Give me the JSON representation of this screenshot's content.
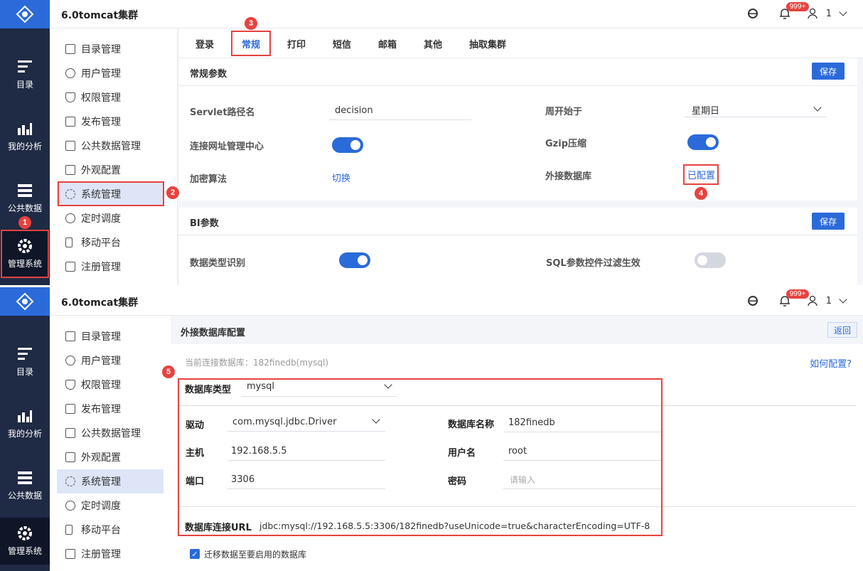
{
  "app_title": "6.0tomcat集群",
  "topbar": {
    "badge": "999+",
    "user": "1"
  },
  "rail": [
    {
      "label": "目录",
      "icon": "catalog-icon"
    },
    {
      "label": "我的分析",
      "icon": "analysis-icon"
    },
    {
      "label": "公共数据",
      "icon": "public-data-icon"
    },
    {
      "label": "管理系统",
      "icon": "gear-icon"
    }
  ],
  "nav": [
    {
      "label": "目录管理"
    },
    {
      "label": "用户管理"
    },
    {
      "label": "权限管理"
    },
    {
      "label": "发布管理"
    },
    {
      "label": "公共数据管理"
    },
    {
      "label": "外观配置"
    },
    {
      "label": "系统管理"
    },
    {
      "label": "定时调度"
    },
    {
      "label": "移动平台"
    },
    {
      "label": "注册管理"
    }
  ],
  "tabs": [
    "登录",
    "常规",
    "打印",
    "短信",
    "邮箱",
    "其他",
    "抽取集群"
  ],
  "general": {
    "title": "常规参数",
    "save": "保存",
    "servlet_label": "Servlet路径名",
    "servlet_value": "decision",
    "week_label": "周开始于",
    "week_value": "星期日",
    "url_center_label": "连接网址管理中心",
    "gzip_label": "Gzip压缩",
    "encrypt_label": "加密算法",
    "encrypt_link": "切换",
    "extdb_label": "外接数据库",
    "extdb_link": "已配置"
  },
  "bi": {
    "title": "BI参数",
    "save": "保存",
    "datatype_label": "数据类型识别",
    "sql_label": "SQL参数控件过滤生效"
  },
  "extdb": {
    "title": "外接数据库配置",
    "back": "返回",
    "current": "当前连接数据库：182finedb(mysql)",
    "how": "如何配置?",
    "dbtype_label": "数据库类型",
    "dbtype_value": "mysql",
    "driver_label": "驱动",
    "driver_value": "com.mysql.jdbc.Driver",
    "dbname_label": "数据库名称",
    "dbname_value": "182finedb",
    "host_label": "主机",
    "host_value": "192.168.5.5",
    "user_label": "用户名",
    "user_value": "root",
    "port_label": "端口",
    "port_value": "3306",
    "pwd_label": "密码",
    "pwd_placeholder": "请输入",
    "url_label": "数据库连接URL",
    "url_value": "jdbc:mysql://192.168.5.5:3306/182finedb?useUnicode=true&characterEncoding=UTF-8",
    "migrate_label": "迁移数据至要启用的数据库"
  },
  "markers": [
    "1",
    "2",
    "3",
    "4",
    "5"
  ]
}
